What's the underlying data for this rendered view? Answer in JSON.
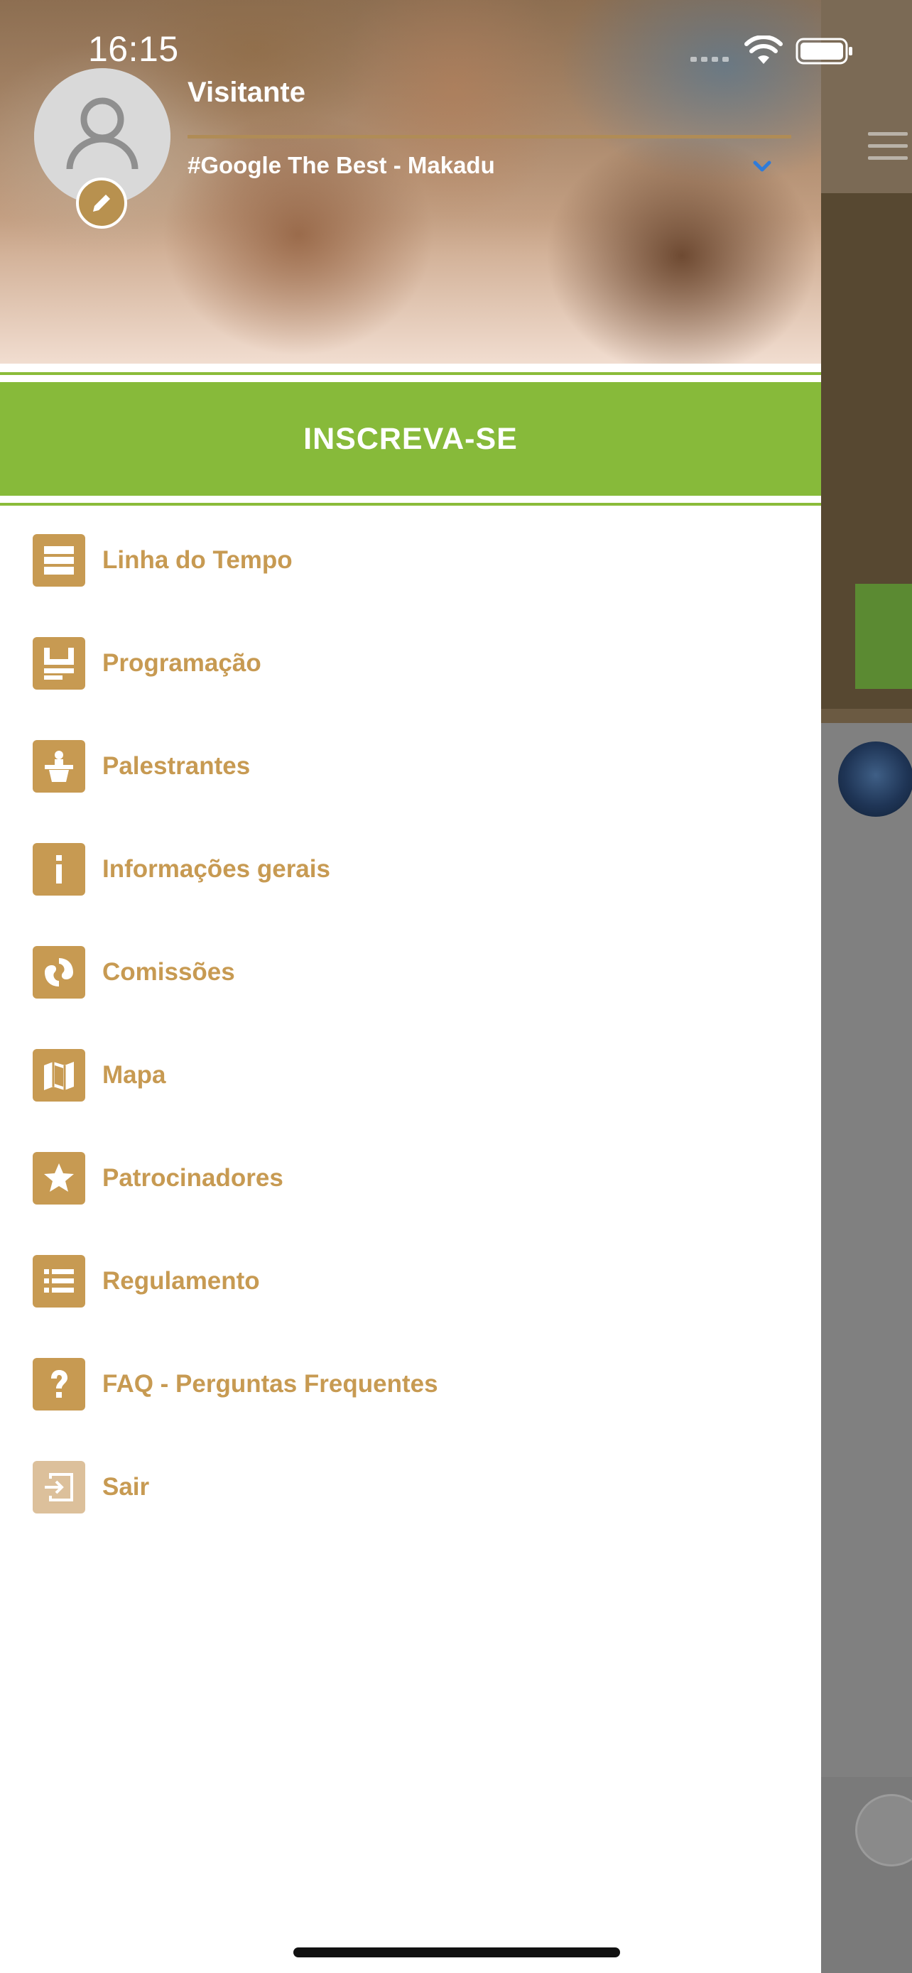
{
  "status_bar": {
    "time": "16:15"
  },
  "drawer": {
    "user_name": "Visitante",
    "event_name": "#Google The Best - Makadu",
    "register_label": "INSCREVA-SE",
    "menu": [
      {
        "label": "Linha do Tempo",
        "icon": "timeline-icon"
      },
      {
        "label": "Programação",
        "icon": "schedule-icon"
      },
      {
        "label": "Palestrantes",
        "icon": "speaker-podium-icon"
      },
      {
        "label": "Informações gerais",
        "icon": "info-icon"
      },
      {
        "label": "Comissões",
        "icon": "committee-icon"
      },
      {
        "label": "Mapa",
        "icon": "map-icon"
      },
      {
        "label": "Patrocinadores",
        "icon": "star-icon"
      },
      {
        "label": "Regulamento",
        "icon": "list-icon"
      },
      {
        "label": "FAQ - Perguntas Frequentes",
        "icon": "question-icon"
      },
      {
        "label": "Sair",
        "icon": "logout-icon"
      }
    ]
  },
  "colors": {
    "accent": "#c79a52",
    "register": "#87ba3a",
    "logout_icon": "#dcc09b"
  }
}
